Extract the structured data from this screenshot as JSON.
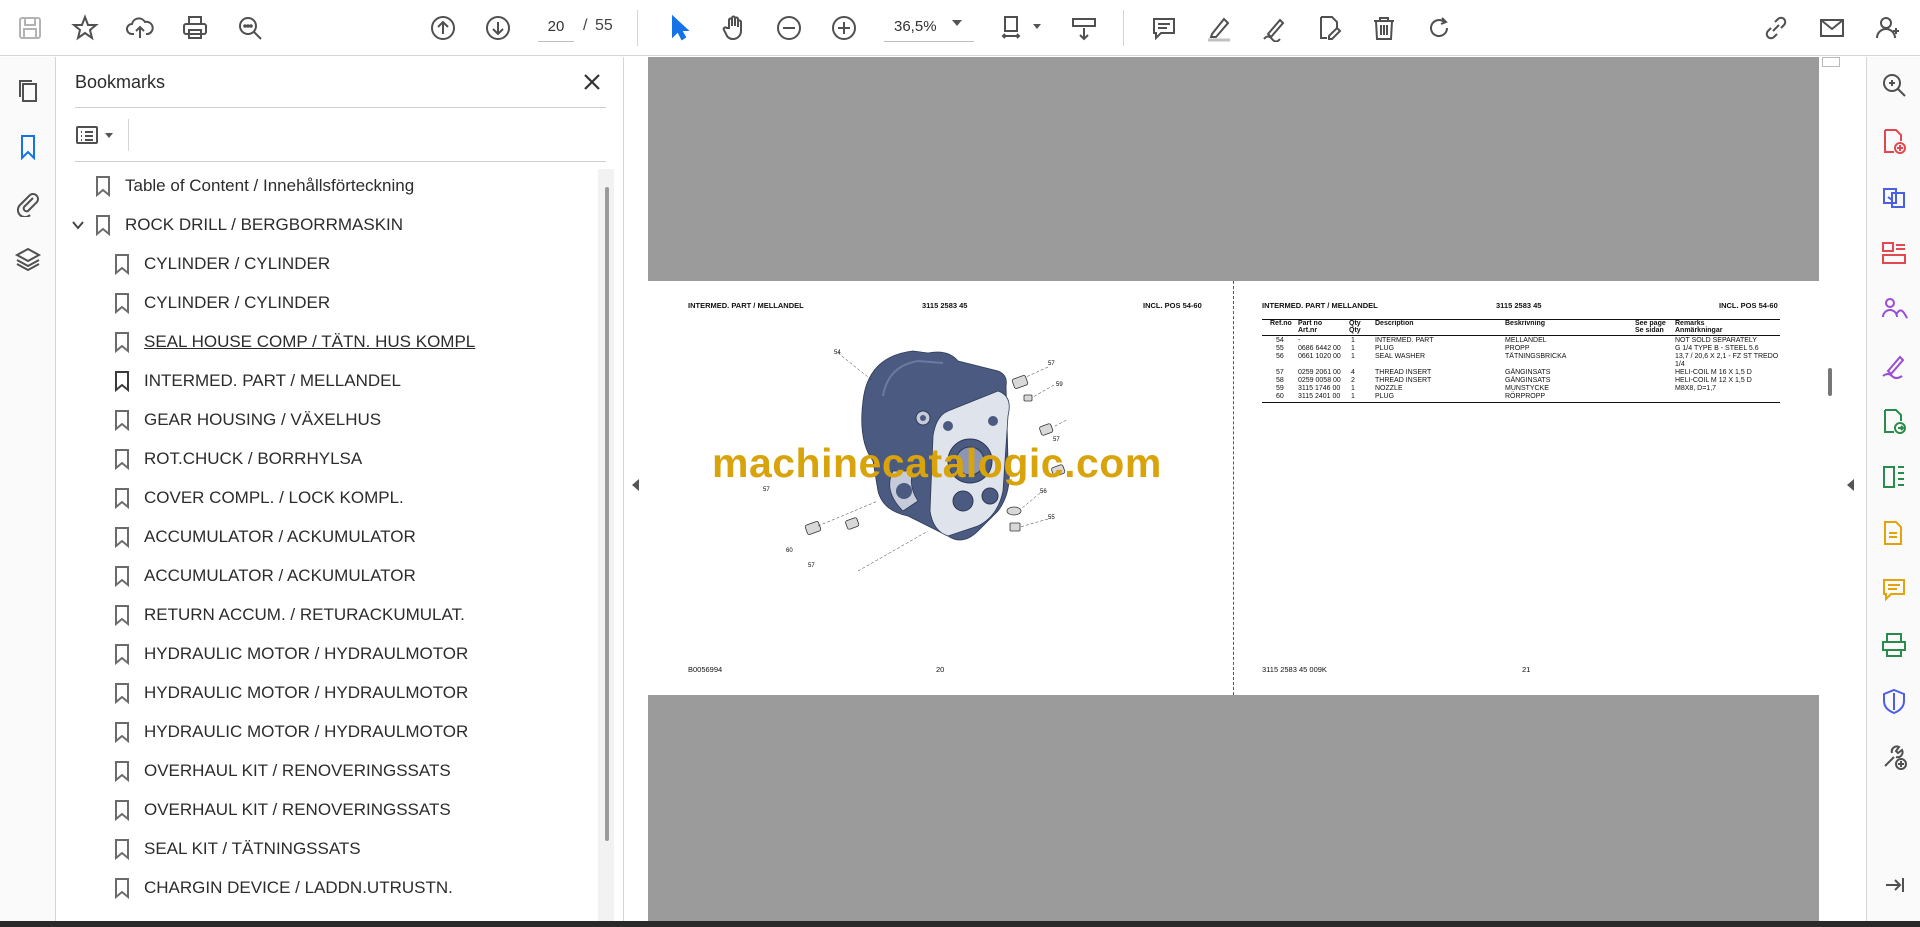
{
  "toolbar": {
    "current_page": "20",
    "page_separator": "/",
    "total_pages": "55",
    "zoom": "36,5%"
  },
  "bookmarks": {
    "title": "Bookmarks",
    "items": [
      {
        "label": "Table of Content / Innehållsförteckning",
        "level": 0
      },
      {
        "label": "ROCK DRILL / BERGBORRMASKIN",
        "level": 0,
        "expanded": true
      },
      {
        "label": "CYLINDER / CYLINDER",
        "level": 1
      },
      {
        "label": "CYLINDER / CYLINDER",
        "level": 1
      },
      {
        "label": "SEAL HOUSE COMP  / TÄTN. HUS KOMPL",
        "level": 1
      },
      {
        "label": "INTERMED. PART / MELLANDEL",
        "level": 1,
        "current": true
      },
      {
        "label": "GEAR HOUSING / VÄXELHUS",
        "level": 1
      },
      {
        "label": "ROT.CHUCK / BORRHYLSA",
        "level": 1
      },
      {
        "label": "COVER COMPL. / LOCK KOMPL.",
        "level": 1
      },
      {
        "label": "ACCUMULATOR / ACKUMULATOR",
        "level": 1
      },
      {
        "label": "ACCUMULATOR / ACKUMULATOR",
        "level": 1
      },
      {
        "label": "RETURN ACCUM. / RETURACKUMULAT.",
        "level": 1
      },
      {
        "label": "HYDRAULIC MOTOR  / HYDRAULMOTOR",
        "level": 1
      },
      {
        "label": "HYDRAULIC MOTOR  / HYDRAULMOTOR",
        "level": 1
      },
      {
        "label": "HYDRAULIC MOTOR  / HYDRAULMOTOR",
        "level": 1
      },
      {
        "label": "OVERHAUL KIT / RENOVERINGSSATS",
        "level": 1
      },
      {
        "label": "OVERHAUL KIT / RENOVERINGSSATS",
        "level": 1
      },
      {
        "label": "SEAL KIT / TÄTNINGSSATS",
        "level": 1
      },
      {
        "label": "CHARGIN DEVICE / LADDN.UTRUSTN.",
        "level": 1
      }
    ]
  },
  "document": {
    "left_page": {
      "header_title": "INTERMED. PART / MELLANDEL",
      "header_part": "3115 2583 45",
      "header_incl": "INCL. POS 54-60",
      "footer_left": "B0056994",
      "footer_page": "20",
      "callouts": [
        "54",
        "57",
        "59",
        "58",
        "57",
        "57",
        "60",
        "57",
        "56",
        "55"
      ]
    },
    "right_page": {
      "header_title": "INTERMED. PART / MELLANDEL",
      "header_part": "3115 2583 45",
      "header_incl": "INCL. POS 54-60",
      "footer_left": "3115 2583 45 009K",
      "footer_page": "21",
      "table_headers": {
        "ref": "Ref.no",
        "partno": "Part no",
        "partno2": "Art.nr",
        "qty": "Qty",
        "qty2": "Qty",
        "desc": "Description",
        "beskr": "Beskrivning",
        "see": "See page",
        "see2": "Se sidan",
        "remarks": "Remarks",
        "remarks2": "Anmärkningar"
      },
      "rows": [
        {
          "ref": "54",
          "part": "-",
          "qty": "1",
          "desc": "INTERMED. PART",
          "beskr": "MELLANDEL",
          "remark": "NOT SOLD SEPARATELY"
        },
        {
          "ref": "55",
          "part": "0686 6442 00",
          "qty": "1",
          "desc": "PLUG",
          "beskr": "PROPP",
          "remark": "G 1/4 TYPE B - STEEL 5.6"
        },
        {
          "ref": "56",
          "part": "0661 1020 00",
          "qty": "1",
          "desc": "SEAL WASHER",
          "beskr": "TÄTNINGSBRICKA",
          "remark": "13,7 / 20,6 X 2,1 - FZ ST TREDO"
        },
        {
          "ref": "",
          "part": "",
          "qty": "",
          "desc": "",
          "beskr": "",
          "remark": "1/4"
        },
        {
          "ref": "57",
          "part": "0259 2061 00",
          "qty": "4",
          "desc": "THREAD INSERT",
          "beskr": "GÄNGINSATS",
          "remark": "HELI-COIL M 16 X 1,5 D"
        },
        {
          "ref": "58",
          "part": "0259 0058 00",
          "qty": "2",
          "desc": "THREAD INSERT",
          "beskr": "GÄNGINSATS",
          "remark": "HELI-COIL M 12 X 1,5 D"
        },
        {
          "ref": "59",
          "part": "3115 1746 00",
          "qty": "1",
          "desc": "NOZZLE",
          "beskr": "MUNSTYCKE",
          "remark": "M8X8, D=1,7"
        },
        {
          "ref": "60",
          "part": "3115 2401 00",
          "qty": "1",
          "desc": "PLUG",
          "beskr": "RÖRPROPP",
          "remark": ""
        }
      ]
    },
    "watermark": "machinecatalogic.com"
  },
  "colors": {
    "canvas_gray": "#9b9b9b",
    "part_blue": "#4a5a80",
    "watermark_gold": "#d9a40b",
    "accent_blue": "#1473e6"
  }
}
